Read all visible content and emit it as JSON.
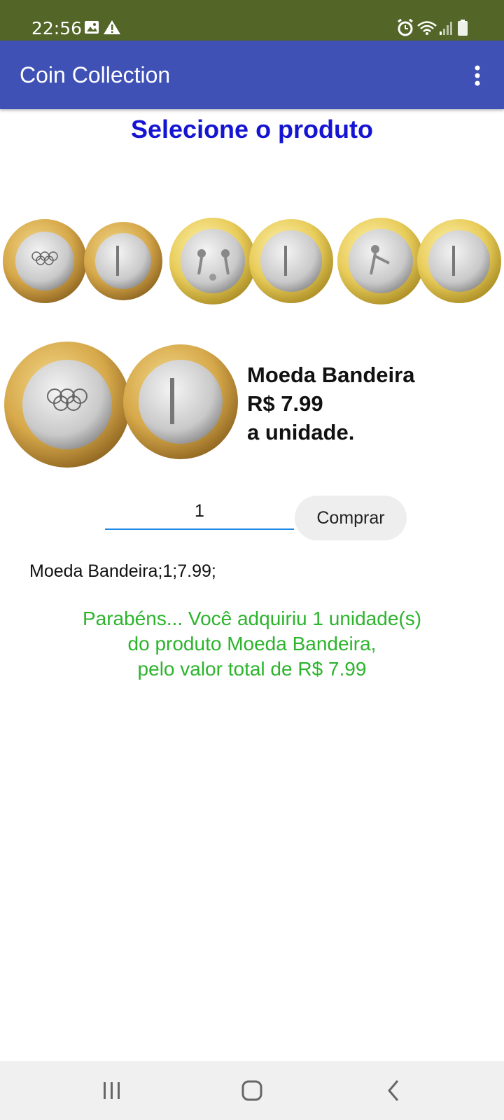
{
  "status_bar": {
    "time": "22:56",
    "left_icons": [
      "image-icon",
      "warning-icon"
    ],
    "right_icons": [
      "alarm-icon",
      "wifi-icon",
      "signal-icon",
      "battery-icon"
    ]
  },
  "app_bar": {
    "title": "Coin Collection",
    "menu_icon": "more-vert-icon"
  },
  "heading": "Selecione o produto",
  "coin_options": [
    {
      "name": "Moeda Bandeira",
      "selected": true
    },
    {
      "name": "Moeda Futebol",
      "selected": false
    },
    {
      "name": "Moeda Atletismo",
      "selected": false
    }
  ],
  "product": {
    "name": "Moeda Bandeira",
    "price_line": "R$ 7.99",
    "unit_line": "a unidade."
  },
  "purchase": {
    "quantity": "1",
    "buy_label": "Comprar"
  },
  "order_record": "Moeda Bandeira;1;7.99;",
  "success": {
    "line1": "Parabéns... Você adquiriu 1 unidade(s)",
    "line2": "do produto Moeda Bandeira,",
    "line3": "pelo valor total de R$ 7.99"
  },
  "nav_bar": [
    "recent-apps-icon",
    "home-icon",
    "back-icon"
  ],
  "colors": {
    "status_bar": "#536628",
    "app_bar": "#3f51b5",
    "heading": "#1414d2",
    "success": "#2cb42c",
    "input_underline": "#1e88e5"
  }
}
